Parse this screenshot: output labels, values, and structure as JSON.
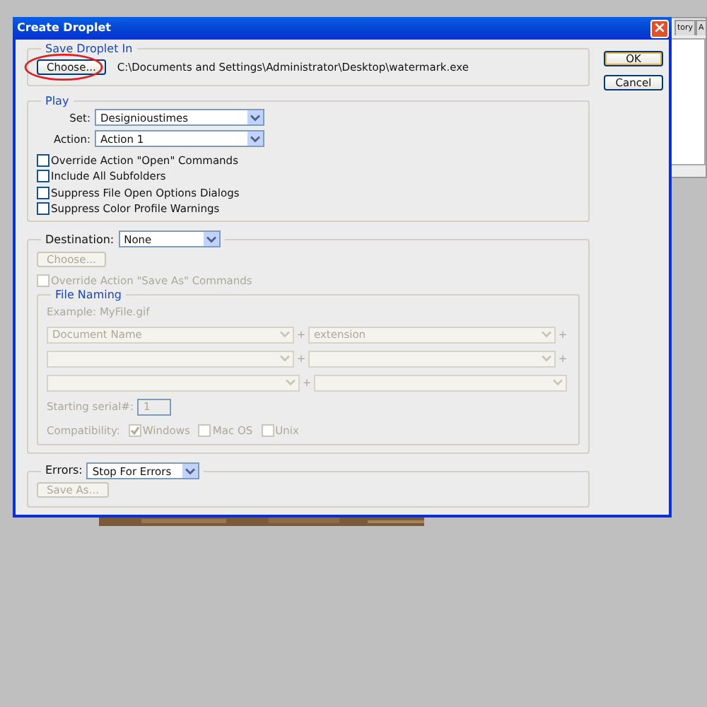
{
  "background_panel": {
    "tabs": [
      {
        "label": "tory"
      },
      {
        "label": "A"
      }
    ]
  },
  "window": {
    "title": "Create Droplet",
    "close": "×"
  },
  "save_droplet_in": {
    "title": "Save Droplet In",
    "choose_button": {
      "label": "Choose...",
      "highlighted": true
    },
    "path": "C:\\Documents and Settings\\Administrator\\Desktop\\watermark.exe"
  },
  "buttons": [
    {
      "label": "OK",
      "default": true
    },
    {
      "label": "Cancel",
      "default": false
    }
  ],
  "play": {
    "title": "Play",
    "set": {
      "label": "Set:",
      "value": "Designioustimes"
    },
    "action": {
      "label": "Action:",
      "value": "Action 1"
    },
    "options": [
      {
        "label": "Override Action \"Open\" Commands",
        "checked": false
      },
      {
        "label": "Include All Subfolders",
        "checked": false
      },
      {
        "label": "Suppress File Open Options Dialogs",
        "checked": false
      },
      {
        "label": "Suppress Color Profile Warnings",
        "checked": false
      }
    ]
  },
  "destination": {
    "label": "Destination:",
    "value": "None",
    "choose_button": {
      "label": "Choose...",
      "disabled": true
    },
    "override": {
      "label": "Override Action \"Save As\" Commands",
      "checked": false,
      "disabled": true
    },
    "file_naming": {
      "title": "File Naming",
      "example": "Example: MyFile.gif",
      "rows": [
        {
          "left": "Document Name",
          "joiner": "+",
          "right": "extension",
          "trailer": "+"
        },
        {
          "joiner": "+",
          "trailer": "+"
        },
        {
          "joiner": "+"
        }
      ],
      "serial": {
        "label": "Starting serial#:",
        "value": "1"
      },
      "compatibility": {
        "label": "Compatibility:",
        "options": [
          {
            "label": "Windows",
            "checked": true
          },
          {
            "label": "Mac OS",
            "checked": false
          },
          {
            "label": "Unix",
            "checked": false
          }
        ]
      },
      "disabled": true
    }
  },
  "errors": {
    "label": "Errors:",
    "value": "Stop For Errors",
    "save_as_button": {
      "label": "Save As...",
      "disabled": true
    }
  }
}
